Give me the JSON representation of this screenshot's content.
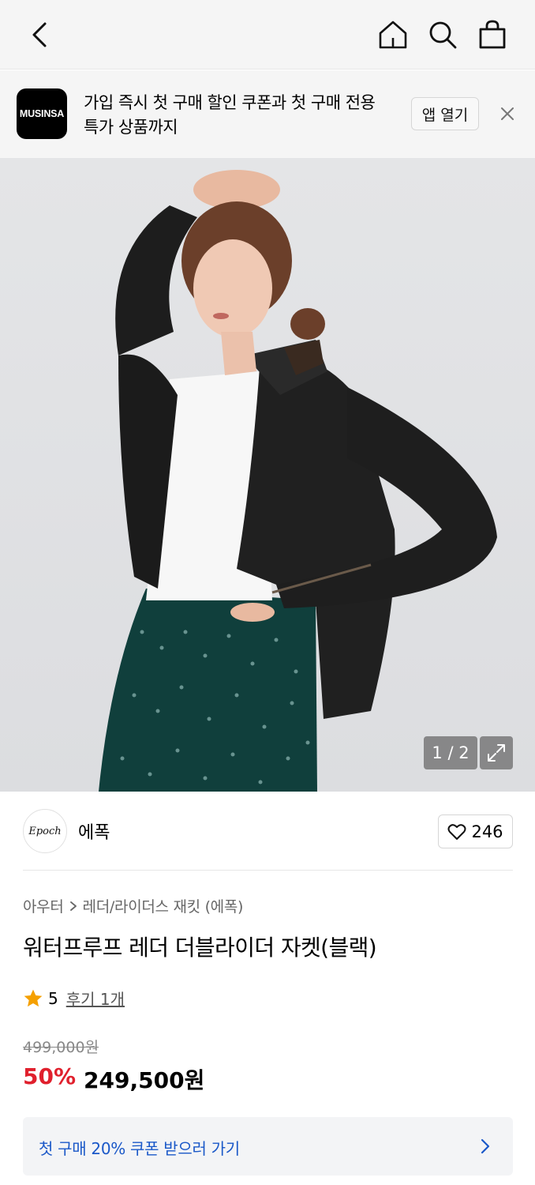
{
  "header": {
    "icons": [
      "chevron-left-icon",
      "home-icon",
      "search-icon",
      "shopping-bag-icon"
    ]
  },
  "banner": {
    "logo_text": "MUSINSA",
    "message_line1": "가입 즉시 첫 구매 할인 쿠폰과 첫 구매 전용",
    "message_line2": "특가 상품까지",
    "open_app_label": "앱 열기"
  },
  "gallery": {
    "counter": "1 / 2"
  },
  "brand": {
    "logo_text": "Epoch",
    "name": "에폭",
    "like_count": "246"
  },
  "product": {
    "breadcrumb": [
      "아우터",
      "레더/라이더스 재킷 (에폭)"
    ],
    "title": "워터프루프 레더 더블라이더 자켓(블랙)",
    "rating": "5",
    "review_link": "후기 1개",
    "original_price": "499,000원",
    "discount": "50%",
    "sale_price": "249,500원"
  },
  "coupon": {
    "label": "첫 구매 20% 쿠폰 받으러 가기"
  },
  "colors": {
    "discount": "#e0202d",
    "coupon_text": "#1a58c8",
    "star": "#f5a000"
  }
}
